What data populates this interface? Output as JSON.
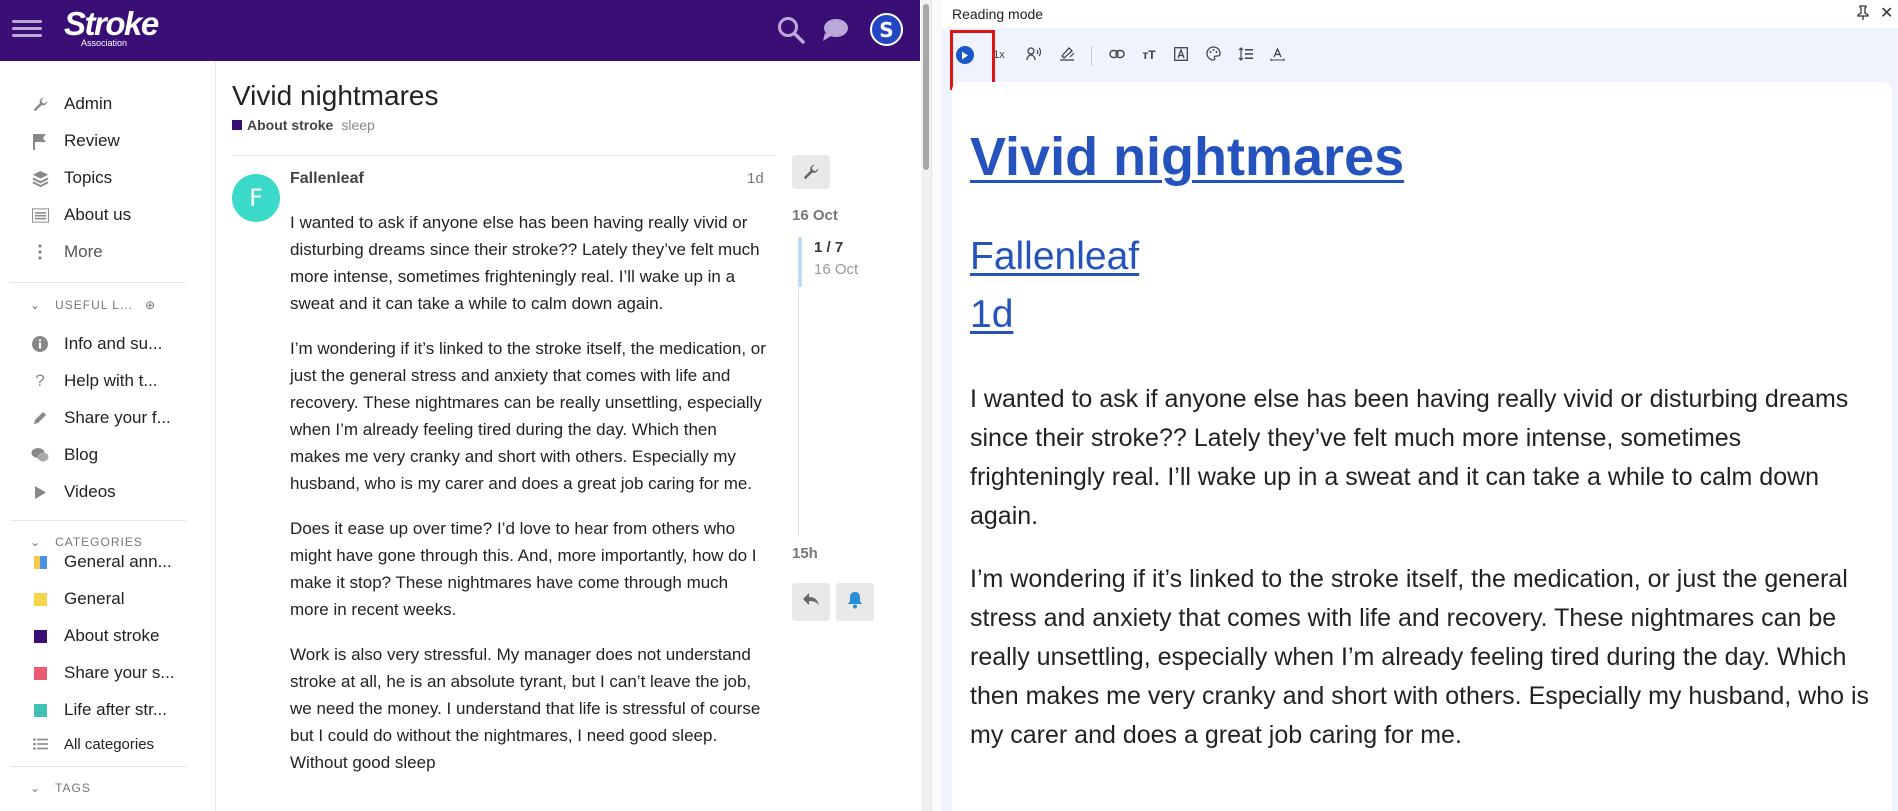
{
  "header": {
    "logo_main": "Stroke",
    "logo_sub": "Association",
    "avatar_letter": "S"
  },
  "sidebar": {
    "items": [
      {
        "label": "Admin",
        "icon": "wrench-icon"
      },
      {
        "label": "Review",
        "icon": "flag-icon"
      },
      {
        "label": "Topics",
        "icon": "layers-icon"
      },
      {
        "label": "About us",
        "icon": "list-icon"
      },
      {
        "label": "More",
        "icon": "vertical-ellipsis-icon"
      }
    ],
    "useful_links": {
      "heading": "USEFUL L...",
      "items": [
        {
          "label": "Info and su...",
          "icon": "info-icon"
        },
        {
          "label": "Help with t...",
          "icon": "question-icon"
        },
        {
          "label": "Share your f...",
          "icon": "pencil-icon"
        },
        {
          "label": "Blog",
          "icon": "chat-icon"
        },
        {
          "label": "Videos",
          "icon": "play-icon"
        }
      ]
    },
    "categories": {
      "heading": "CATEGORIES",
      "items": [
        {
          "label": "General ann...",
          "colors": [
            "#f7c948",
            "#4a90e2"
          ]
        },
        {
          "label": "General",
          "colors": [
            "#f7d54a"
          ]
        },
        {
          "label": "About stroke",
          "colors": [
            "#3a0f75"
          ]
        },
        {
          "label": "Share your s...",
          "colors": [
            "#ec5a72"
          ]
        },
        {
          "label": "Life after str...",
          "colors": [
            "#3fc2b0"
          ]
        }
      ],
      "all_label": "All categories"
    },
    "tags_heading": "TAGS"
  },
  "topic": {
    "title": "Vivid nightmares",
    "category": "About stroke",
    "tag": "sleep",
    "post": {
      "avatar_letter": "F",
      "username": "Fallenleaf",
      "age": "1d",
      "paragraphs": [
        "I wanted to ask if anyone else has been having really vivid or disturbing dreams since their stroke?? Lately they’ve felt much more intense, sometimes frighteningly real. I’ll wake up in a sweat and it can take a while to calm down again.",
        "I’m wondering if it’s linked to the stroke itself, the medication, or just the general stress and anxiety that comes with life and recovery. These nightmares can be really unsettling, especially when I’m already feeling tired during the day. Which then makes me very cranky and short with others. Especially my husband, who is my carer and does a great job caring for me.",
        "Does it ease up over time? I’d love to hear from others who might have gone through this. And, more importantly, how do I make it stop? These nightmares have come through much more in recent weeks.",
        "Work is also very stressful. My manager does not understand stroke at all, he is an absolute tyrant, but I can’t leave the job, we need the money. I understand that life is stressful of course but I could do without the nightmares, I need good sleep. Without good sleep"
      ]
    }
  },
  "timeline": {
    "date_top": "16 Oct",
    "position": "1 / 7",
    "position_date": "16 Oct",
    "date_bottom": "15h"
  },
  "reading_mode": {
    "title": "Reading mode",
    "close": "✕",
    "speed": "1x",
    "h1": "Vivid nightmares",
    "author": "Fallenleaf",
    "age": "1d",
    "paragraphs": [
      "I wanted to ask if anyone else has been having really vivid or disturbing dreams since their stroke?? Lately they’ve felt much more intense, sometimes frighteningly real. I’ll wake up in a sweat and it can take a while to calm down again.",
      "I’m wondering if it’s linked to the stroke itself, the medication, or just the general stress and anxiety that comes with life and recovery. These nightmares can be really unsettling, especially when I’m already feeling tired during the day. Which then makes me very cranky and short with others. Especially my husband, who is my carer and does a great job caring for me."
    ],
    "toolbar_icons": [
      "play-icon",
      "speed-label",
      "voice-icon",
      "highlighter-icon",
      "link-icon",
      "text-size-icon",
      "font-icon",
      "palette-icon",
      "line-spacing-icon",
      "letter-spacing-icon"
    ],
    "accent": "#1a57c9"
  }
}
